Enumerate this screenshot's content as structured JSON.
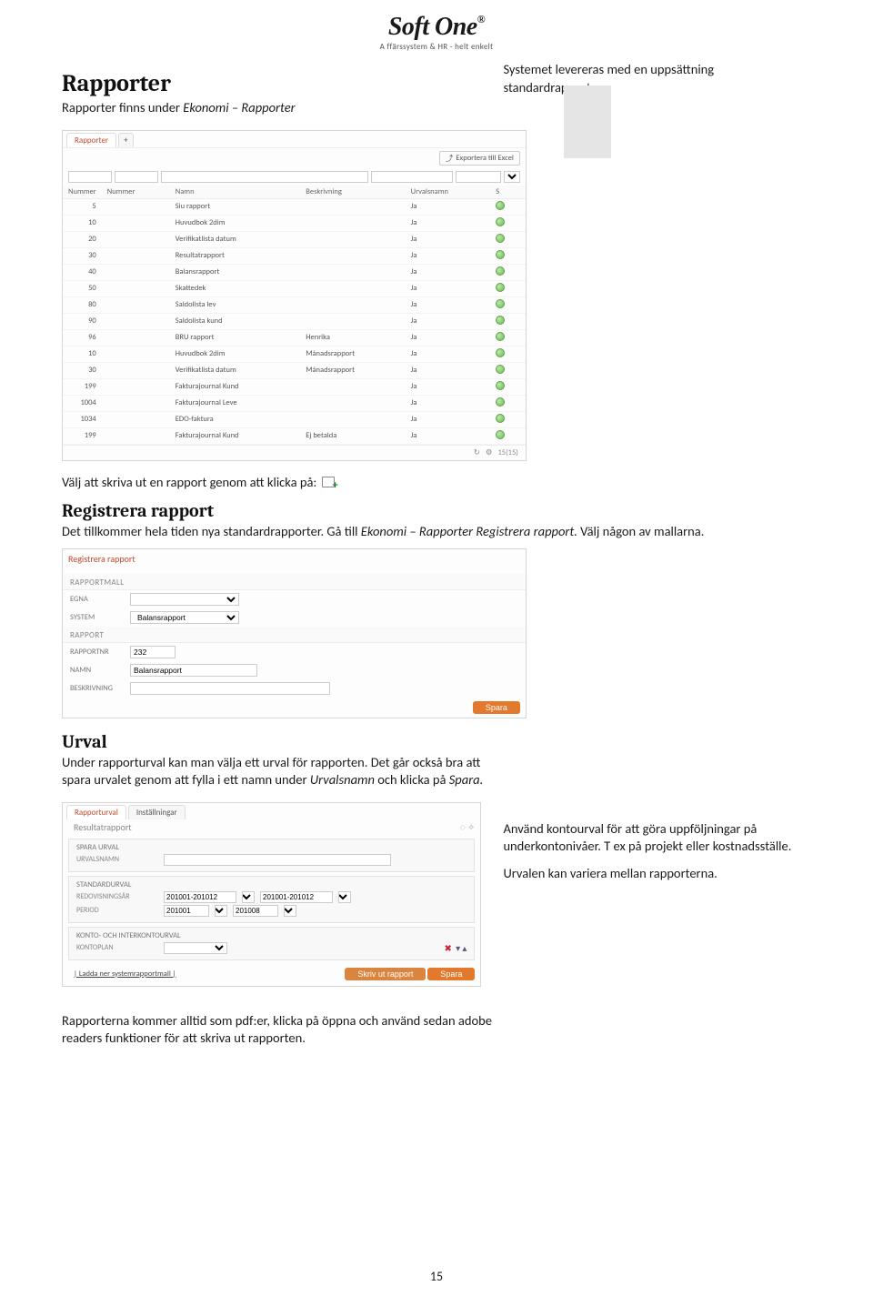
{
  "logo": {
    "main": "Soft One",
    "reg": "®",
    "sub": "A ffärssystem & HR - helt enkelt"
  },
  "sections": {
    "rapporter_h1": "Rapporter",
    "rapporter_body1": "Rapporter finns under ",
    "rapporter_body1_em": "Ekonomi – Rapporter",
    "side_intro": "Systemet levereras med en uppsättning standardrapporter.",
    "print_hint": "Välj att skriva ut en rapport genom att klicka på:",
    "reg_h2": "Registrera rapport",
    "reg_body": "Det tillkommer hela tiden nya standardrapporter. Gå till ",
    "reg_body_em": "Ekonomi – Rapporter Registrera rapport.",
    "reg_body_tail": " Välj någon av mallarna.",
    "urval_h2": "Urval",
    "urval_body": "Under rapporturval kan man välja ett urval för rapporten. Det går också bra att spara urvalet genom att fylla i ett namn under ",
    "urval_body_em": "Urvalsnamn",
    "urval_body_tail": " och klicka på ",
    "urval_body_em2": "Spara.",
    "side_urval1": "Använd kontourval för att göra uppföljningar på underkontonivåer. T ex på projekt eller kostnadsställe.",
    "side_urval2": "Urvalen kan variera mellan rapporterna.",
    "pdf_note": "Rapporterna kommer alltid som pdf:er, klicka på öppna och använd sedan adobe readers funktioner för att skriva ut rapporten."
  },
  "mock_reports": {
    "tab": "Rapporter",
    "export_btn": "Exportera till Excel",
    "headers": [
      "Nummer",
      "Nummer",
      "Namn",
      "Beskrivning",
      "Urvalsnamn",
      "S"
    ],
    "rows": [
      {
        "a": "5",
        "n": "Siu rapport",
        "b": "",
        "u": "Ja"
      },
      {
        "a": "10",
        "n": "Huvudbok 2dim",
        "b": "",
        "u": "Ja"
      },
      {
        "a": "20",
        "n": "Verifikatlista datum",
        "b": "",
        "u": "Ja"
      },
      {
        "a": "30",
        "n": "Resultatrapport",
        "b": "",
        "u": "Ja"
      },
      {
        "a": "40",
        "n": "Balansrapport",
        "b": "",
        "u": "Ja"
      },
      {
        "a": "50",
        "n": "Skattedek",
        "b": "",
        "u": "Ja"
      },
      {
        "a": "80",
        "n": "Saldolista lev",
        "b": "",
        "u": "Ja"
      },
      {
        "a": "90",
        "n": "Saldolista kund",
        "b": "",
        "u": "Ja"
      },
      {
        "a": "96",
        "n": "BRU rapport",
        "b": "Henrika",
        "u": "Ja"
      },
      {
        "a": "10",
        "n": "Huvudbok 2dim",
        "b": "Månadsrapport",
        "u": "Ja"
      },
      {
        "a": "30",
        "n": "Verifikatlista datum",
        "b": "Månadsrapport",
        "u": "Ja"
      },
      {
        "a": "199",
        "n": "Fakturajournal Kund",
        "b": "",
        "u": "Ja"
      },
      {
        "a": "1004",
        "n": "Fakturajournal Leve",
        "b": "",
        "u": "Ja"
      },
      {
        "a": "1034",
        "n": "EDO-faktura",
        "b": "",
        "u": "Ja"
      },
      {
        "a": "199",
        "n": "Fakturajournal Kund",
        "b": "Ej betalda",
        "u": "Ja"
      }
    ],
    "footer_count": "15(15)"
  },
  "mock_register": {
    "title": "Registrera rapport",
    "sec1": "RAPPORTMALL",
    "lbl_egna": "EGNA",
    "lbl_system": "SYSTEM",
    "system_val": "Balansrapport",
    "sec2": "RAPPORT",
    "lbl_nr": "RAPPORTNR",
    "nr_val": "232",
    "lbl_namn": "NAMN",
    "namn_val": "Balansrapport",
    "lbl_besk": "BESKRIVNING",
    "save": "Spara"
  },
  "mock_urval": {
    "tab1": "Rapporturval",
    "tab2": "Inställningar",
    "subtitle": "Resultatrapport",
    "sec1": "SPARA URVAL",
    "lbl_urvalsnamn": "URVALSNAMN",
    "sec2": "STANDARDURVAL",
    "lbl_redov": "REDOVISNINGSÅR",
    "redov_a": "201001-201012",
    "redov_b": "201001-201012",
    "lbl_period": "PERIOD",
    "period_a": "201001",
    "period_b": "201008",
    "sec3": "KONTO- OCH INTERKONTOURVAL",
    "lbl_kontoplan": "Kontoplan",
    "link": "| Ladda ner systemrapportmall |",
    "btn1": "Skriv ut rapport",
    "btn2": "Spara"
  },
  "page_number": "15"
}
